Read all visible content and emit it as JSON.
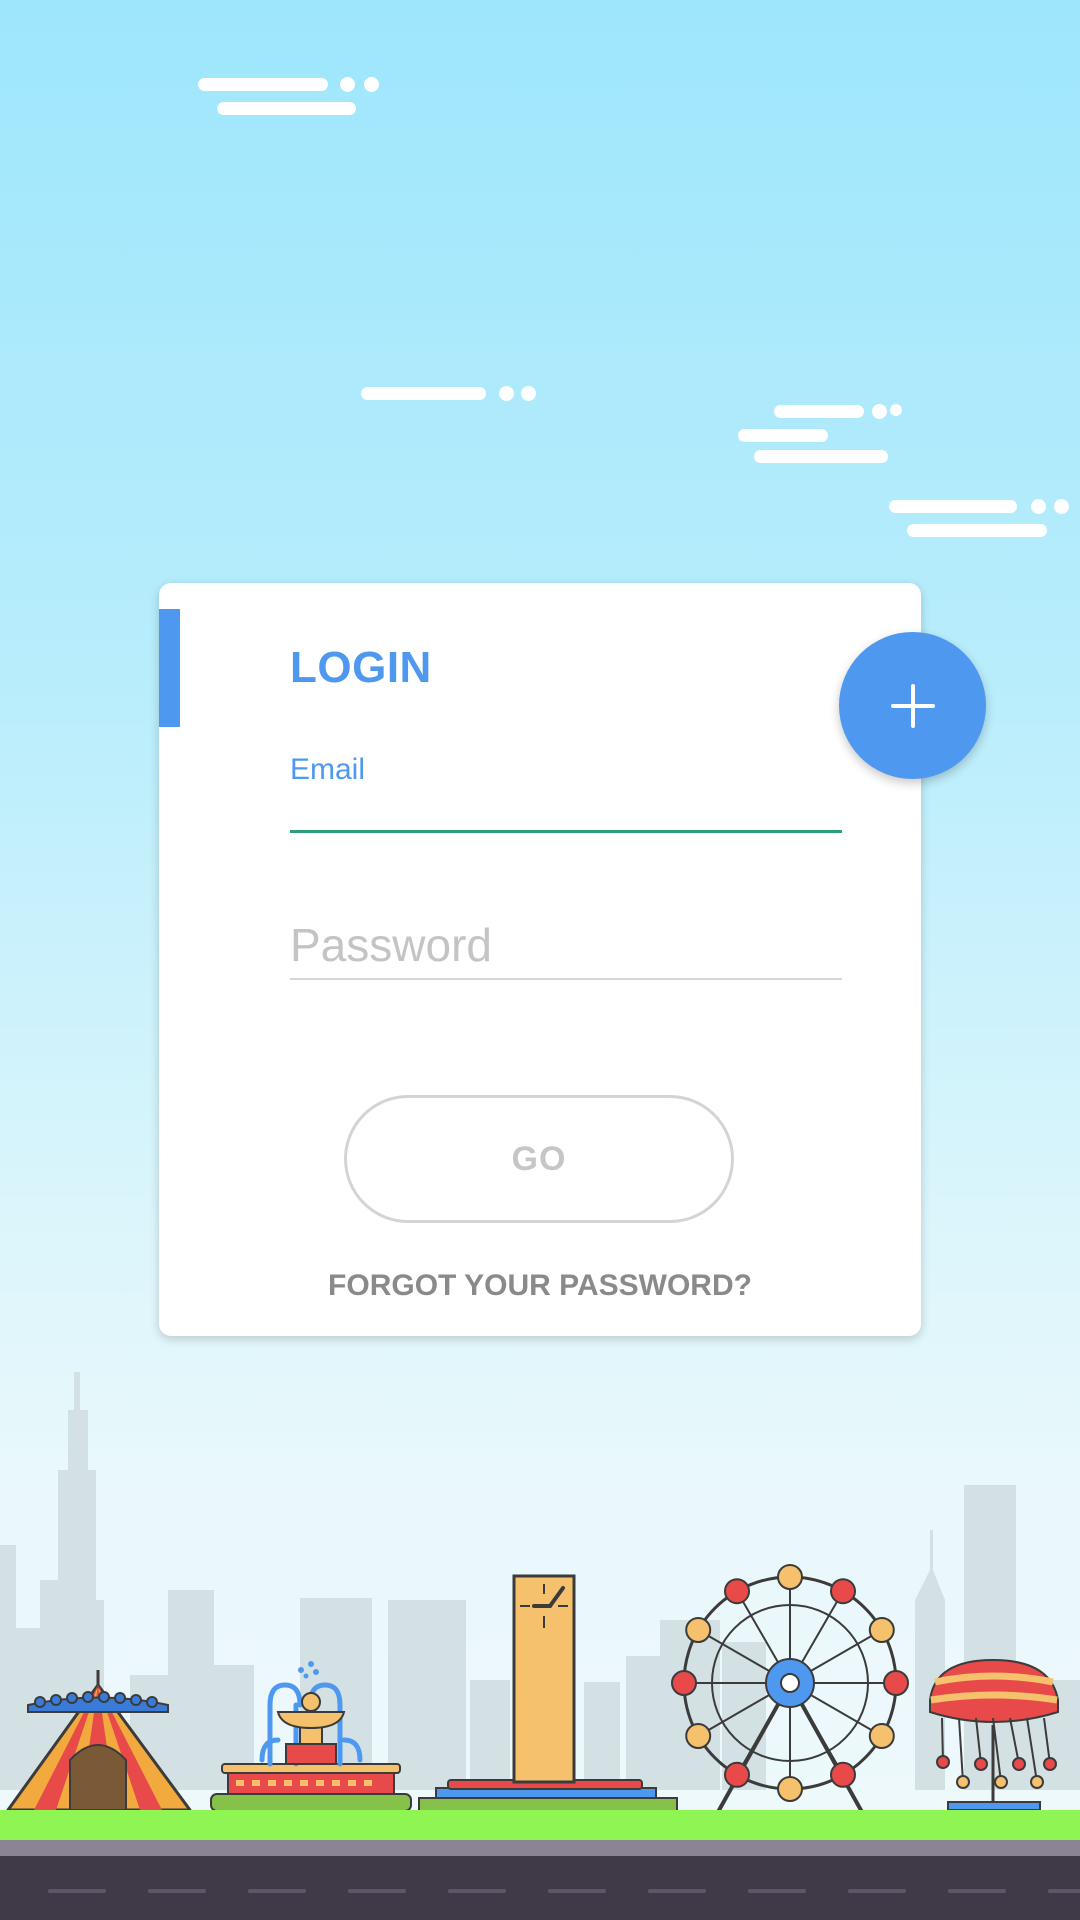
{
  "login_card": {
    "title": "LOGIN",
    "email_label": "Email",
    "email_value": "",
    "password_placeholder": "Password",
    "go_label": "GO",
    "forgot_label": "FORGOT YOUR PASSWORD?"
  },
  "fab": {
    "icon": "plus-icon"
  },
  "colors": {
    "accent": "#4f98f0",
    "email_underline": "#2f9c7c",
    "sky_top": "#9ee6fc",
    "sky_bottom": "#eef9fb",
    "grass": "#8ef552",
    "road": "#403a48"
  }
}
